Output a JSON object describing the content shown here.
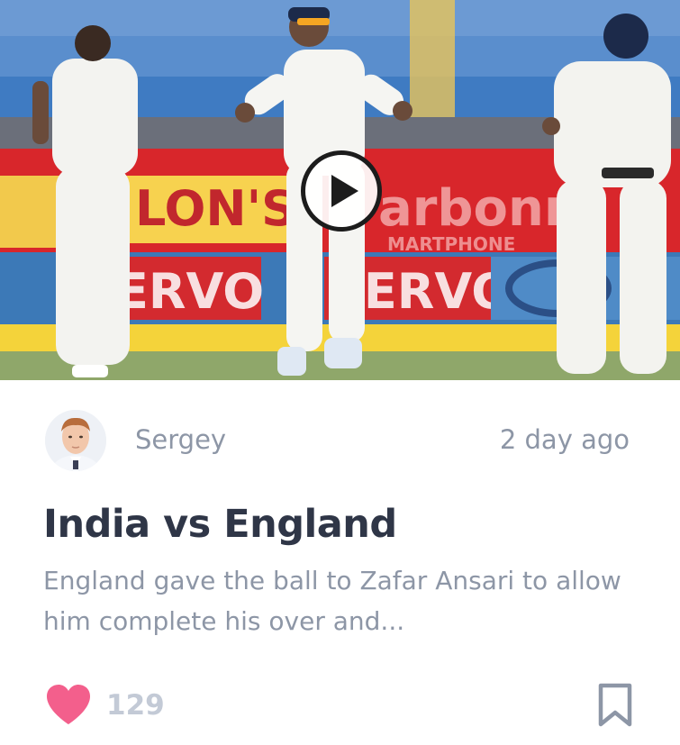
{
  "post": {
    "author_name": "Sergey",
    "time_ago": "2 day ago",
    "title": "India vs England",
    "excerpt": "England gave the ball to Zafar Ansari to allow him complete his over and...",
    "likes": "129"
  },
  "media": {
    "type": "video",
    "subject": "cricket-match-celebration"
  },
  "icons": {
    "play": "play-icon",
    "like": "heart-icon",
    "bookmark": "bookmark-icon"
  },
  "colors": {
    "title": "#2f3647",
    "muted_text": "#8d96a6",
    "like_heart": "#f35f8c",
    "bookmark": "#8d96a6",
    "like_count": "#c3cad6"
  }
}
